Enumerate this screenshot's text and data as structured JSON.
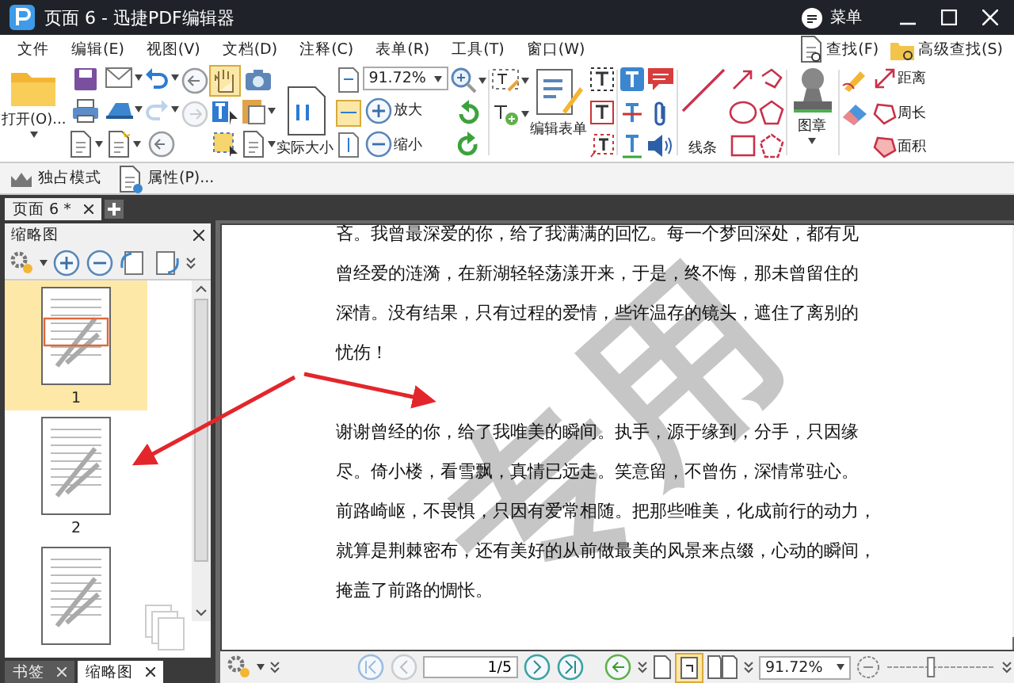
{
  "window": {
    "title": "页面 6 - 迅捷PDF编辑器",
    "menu_button": "菜单"
  },
  "menu": [
    "文件",
    "编辑(E)",
    "视图(V)",
    "文档(D)",
    "注释(C)",
    "表单(R)",
    "工具(T)",
    "窗口(W)"
  ],
  "search_buttons": [
    "查找(F)",
    "高级查找(S)"
  ],
  "ribbon": {
    "open": "打开(O)...",
    "actual_size": "实际大小",
    "zoom": "91.72%",
    "zoom_in": "放大",
    "zoom_out": "缩小",
    "edit_form": "编辑表单",
    "lines": "线条",
    "stamp": "图章",
    "measure": [
      "距离",
      "周长",
      "面积"
    ],
    "hand_selected": true
  },
  "toolbar": [
    "独占模式",
    "属性(P)..."
  ],
  "doc_tabs": [
    {
      "label": "页面 6 *",
      "selected": true
    }
  ],
  "panel": {
    "title": "缩略图",
    "thumbnails": [
      {
        "label": "1",
        "selected": true
      },
      {
        "label": "2",
        "selected": false
      },
      {
        "selected": false
      }
    ],
    "tabs": [
      {
        "label": "书签",
        "selected": false
      },
      {
        "label": "缩略图",
        "selected": true
      }
    ]
  },
  "document": {
    "watermark": "专用",
    "paragraphs": [
      [
        "吝。我曾最深爱的你，给了我满满的回忆。每一个梦回深处，都有见",
        "曾经爱的涟漪，在新湖轻轻荡漾开来，于是，终不悔，那未曾留住的",
        "深情。没有结果，只有过程的爱情，些许温存的镜头，遮住了离别的",
        "忧伤！"
      ],
      [
        "谢谢曾经的你，给了我唯美的瞬间。执手，源于缘到，分手，只因缘",
        "尽。倚小楼，看雪飘，真情已远走。笑意留，不曾伤，深情常驻心。",
        "前路崎岖，不畏惧，只因有爱常相随。把那些唯美，化成前行的动力，",
        "就算是荆棘密布，还有美好的从前做最美的风景来点缀，心动的瞬间，",
        "掩盖了前路的惆怅。"
      ]
    ]
  },
  "status": {
    "page": "1/5",
    "zoom": "91.72%",
    "fit_page_selected": true,
    "zoom_slider": {
      "level": 0.4
    }
  }
}
